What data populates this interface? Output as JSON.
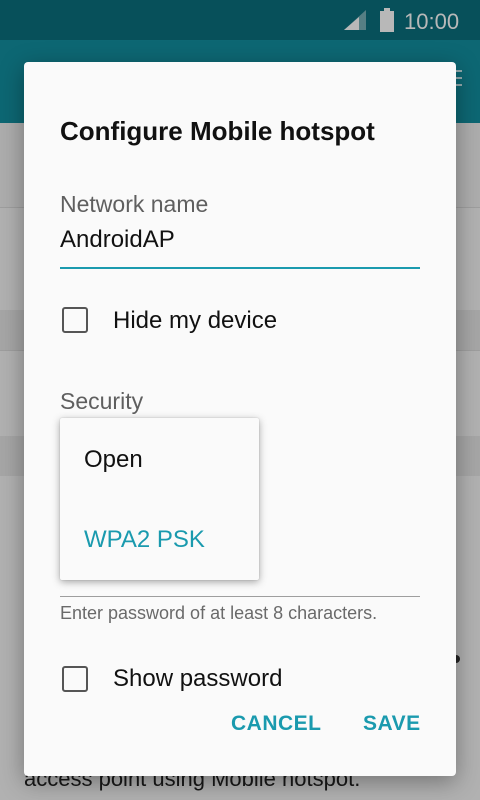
{
  "status_bar": {
    "time": "10:00",
    "icons": [
      "signal-icon",
      "battery-icon"
    ]
  },
  "background": {
    "partial_text": "access point using Mobile hotspot."
  },
  "dialog": {
    "title": "Configure Mobile hotspot",
    "network_name": {
      "label": "Network name",
      "value": "AndroidAP"
    },
    "hide_device": {
      "label": "Hide my device",
      "checked": false
    },
    "security": {
      "label": "Security",
      "options": [
        "Open",
        "WPA2 PSK"
      ],
      "selected": "WPA2 PSK"
    },
    "password_hint": "Enter password of at least 8 characters.",
    "show_password": {
      "label": "Show password",
      "checked": false
    },
    "buttons": {
      "cancel": "CANCEL",
      "save": "SAVE"
    }
  },
  "colors": {
    "accent": "#1a9aae",
    "status_bar": "#0a6f7d",
    "app_bar": "#128fa0",
    "dialog_bg": "#fafafa"
  }
}
